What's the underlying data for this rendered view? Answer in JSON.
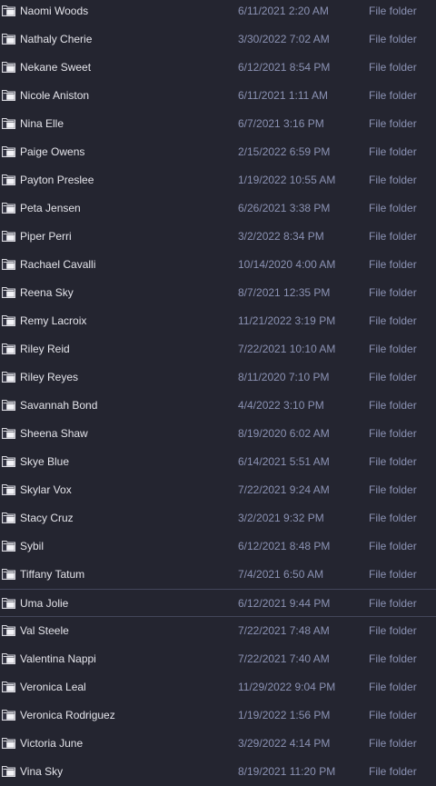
{
  "folder_icon": "folder-icon",
  "colors": {
    "background": "#242530",
    "name_text": "#e4e4ea",
    "meta_text": "#8b92b3",
    "selection_border": "#43465a"
  },
  "selected_index": 21,
  "items": [
    {
      "name": "Naomi Woods",
      "date": "6/11/2021 2:20 AM",
      "type": "File folder"
    },
    {
      "name": "Nathaly Cherie",
      "date": "3/30/2022 7:02 AM",
      "type": "File folder"
    },
    {
      "name": "Nekane Sweet",
      "date": "6/12/2021 8:54 PM",
      "type": "File folder"
    },
    {
      "name": "Nicole Aniston",
      "date": "6/11/2021 1:11 AM",
      "type": "File folder"
    },
    {
      "name": "Nina Elle",
      "date": "6/7/2021 3:16 PM",
      "type": "File folder"
    },
    {
      "name": "Paige Owens",
      "date": "2/15/2022 6:59 PM",
      "type": "File folder"
    },
    {
      "name": "Payton Preslee",
      "date": "1/19/2022 10:55 AM",
      "type": "File folder"
    },
    {
      "name": "Peta Jensen",
      "date": "6/26/2021 3:38 PM",
      "type": "File folder"
    },
    {
      "name": "Piper Perri",
      "date": "3/2/2022 8:34 PM",
      "type": "File folder"
    },
    {
      "name": "Rachael Cavalli",
      "date": "10/14/2020 4:00 AM",
      "type": "File folder"
    },
    {
      "name": "Reena Sky",
      "date": "8/7/2021 12:35 PM",
      "type": "File folder"
    },
    {
      "name": "Remy Lacroix",
      "date": "11/21/2022 3:19 PM",
      "type": "File folder"
    },
    {
      "name": "Riley Reid",
      "date": "7/22/2021 10:10 AM",
      "type": "File folder"
    },
    {
      "name": "Riley Reyes",
      "date": "8/11/2020 7:10 PM",
      "type": "File folder"
    },
    {
      "name": "Savannah Bond",
      "date": "4/4/2022 3:10 PM",
      "type": "File folder"
    },
    {
      "name": "Sheena Shaw",
      "date": "8/19/2020 6:02 AM",
      "type": "File folder"
    },
    {
      "name": "Skye Blue",
      "date": "6/14/2021 5:51 AM",
      "type": "File folder"
    },
    {
      "name": "Skylar Vox",
      "date": "7/22/2021 9:24 AM",
      "type": "File folder"
    },
    {
      "name": "Stacy Cruz",
      "date": "3/2/2021 9:32 PM",
      "type": "File folder"
    },
    {
      "name": "Sybil",
      "date": "6/12/2021 8:48 PM",
      "type": "File folder"
    },
    {
      "name": "Tiffany Tatum",
      "date": "7/4/2021 6:50 AM",
      "type": "File folder"
    },
    {
      "name": "Uma Jolie",
      "date": "6/12/2021 9:44 PM",
      "type": "File folder"
    },
    {
      "name": "Val Steele",
      "date": "7/22/2021 7:48 AM",
      "type": "File folder"
    },
    {
      "name": "Valentina Nappi",
      "date": "7/22/2021 7:40 AM",
      "type": "File folder"
    },
    {
      "name": "Veronica Leal",
      "date": "11/29/2022 9:04 PM",
      "type": "File folder"
    },
    {
      "name": "Veronica Rodriguez",
      "date": "1/19/2022 1:56 PM",
      "type": "File folder"
    },
    {
      "name": "Victoria June",
      "date": "3/29/2022 4:14 PM",
      "type": "File folder"
    },
    {
      "name": "Vina Sky",
      "date": "8/19/2021 11:20 PM",
      "type": "File folder"
    }
  ]
}
